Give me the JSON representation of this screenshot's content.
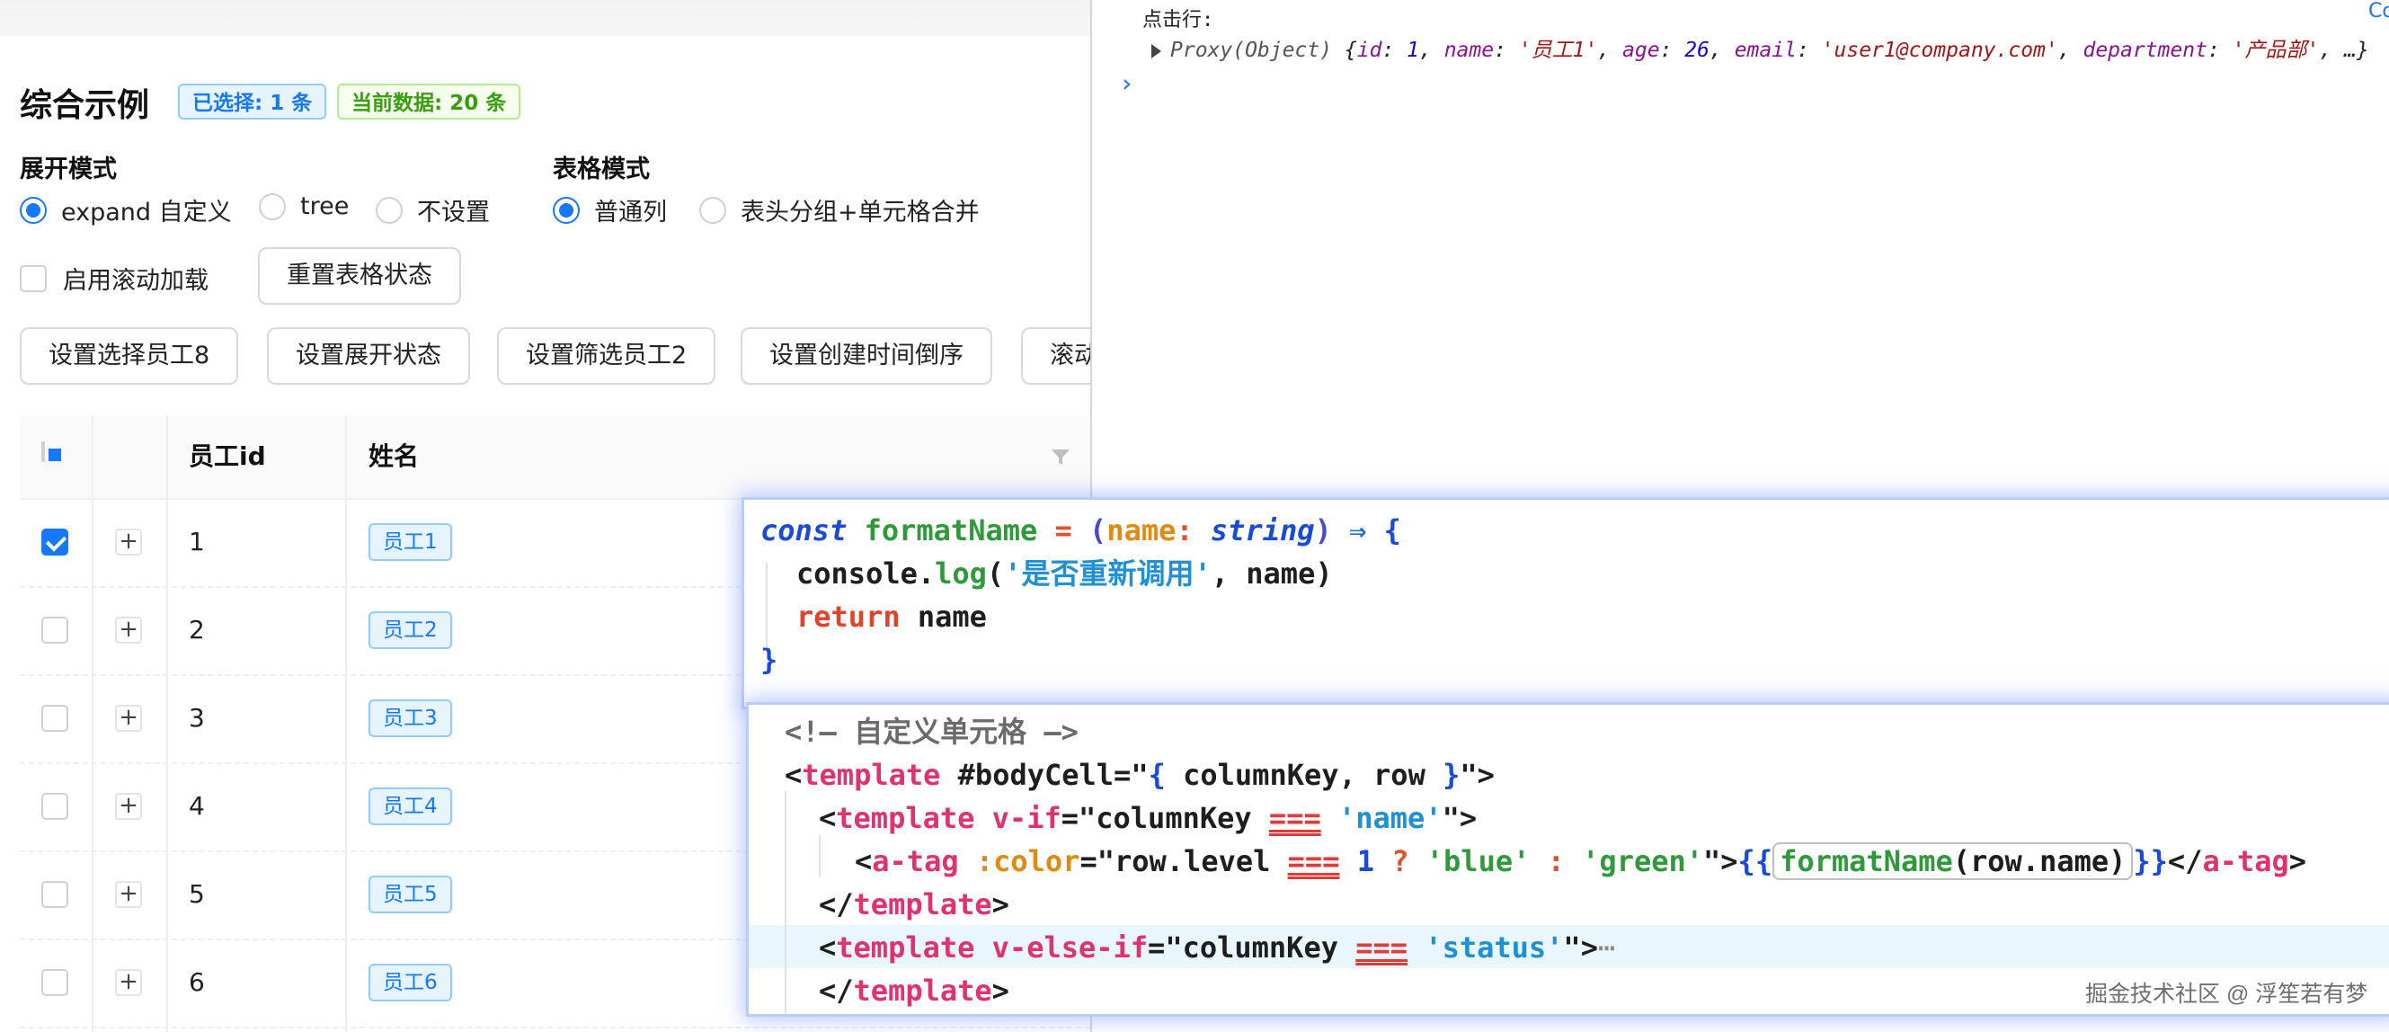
{
  "demo": {
    "title": "综合示例",
    "selected_badge": "已选择: 1 条",
    "data_badge": "当前数据: 20 条",
    "expand_mode": {
      "label": "展开模式",
      "options": [
        "expand 自定义",
        "tree",
        "不设置"
      ],
      "selected": "expand 自定义"
    },
    "table_mode": {
      "label": "表格模式",
      "options": [
        "普通列",
        "表头分组+单元格合并"
      ],
      "selected": "普通列"
    },
    "scroll_load_label": "启用滚动加载",
    "reset_button": "重置表格状态",
    "actions": [
      "设置选择员工8",
      "设置展开状态",
      "设置筛选员工2",
      "设置创建时间倒序",
      "滚动"
    ],
    "table": {
      "columns": [
        "员工id",
        "姓名"
      ],
      "rows": [
        {
          "id": "1",
          "name": "员工1",
          "checked": true
        },
        {
          "id": "2",
          "name": "员工2",
          "checked": false
        },
        {
          "id": "3",
          "name": "员工3",
          "checked": false
        },
        {
          "id": "4",
          "name": "员工4",
          "checked": false
        },
        {
          "id": "5",
          "name": "员工5",
          "checked": false
        },
        {
          "id": "6",
          "name": "员工6",
          "checked": false
        }
      ],
      "expand_symbol": "+"
    }
  },
  "console": {
    "label": "点击行:",
    "proxy_prefix": "Proxy(Object)",
    "obj": {
      "open": "{",
      "id_key": "id",
      "id_val": "1",
      "name_key": "name",
      "name_val": "'员工1'",
      "age_key": "age",
      "age_val": "26",
      "email_key": "email",
      "email_val": "'user1@company.com'",
      "dept_key": "department",
      "dept_val": "'产品部'",
      "tail": ", …}"
    },
    "prompt": "›",
    "corner": "Co"
  },
  "code1": {
    "const": "const",
    "fn_name": "formatName",
    "eq": "=",
    "lparen": "(",
    "param": "name",
    "colon": ":",
    "type": "string",
    "rparen": ")",
    "arrow": "⇒",
    "lbrace": "{",
    "console": "console.",
    "log": "log",
    "log_open": "(",
    "log_str": "'是否重新调用'",
    "log_rest": ", name)",
    "ret": "return",
    "ret_val": " name",
    "rbrace": "}"
  },
  "code2": {
    "comment": "<!— 自定义单元格 —>",
    "l2_open": "<",
    "l2_tag": "template",
    "l2_attr": " #bodyCell",
    "l2_eq": "=\"",
    "l2_brace_l": "{",
    "l2_mid": " columnKey, row ",
    "l2_brace_r": "}",
    "l2_end": "\">",
    "l3_open": "<",
    "l3_tag": "template",
    "l3_dir": " v-if",
    "l3_mid": "=\"columnKey ",
    "l3_eq": "===",
    "l3_str": " 'name'",
    "l3_end": "\">",
    "l4_open": "<",
    "l4_tag": "a-tag",
    "l4_attr": " :color",
    "l4_mid": "=\"row.level ",
    "l4_eq": "===",
    "l4_num": " 1",
    "l4_q": " ? ",
    "l4_blue": "'blue'",
    "l4_colon": " : ",
    "l4_green": "'green'",
    "l4_end": "\">",
    "l4_mus_l": "{{",
    "l4_call_fn": "formatName",
    "l4_call_arg": "(row.name)",
    "l4_mus_r": "}}",
    "l4_close_open": "</",
    "l4_close_tag": "a-tag",
    "l4_close_end": ">",
    "l5_open": "</",
    "l5_tag": "template",
    "l5_end": ">",
    "l6_open": "<",
    "l6_tag": "template",
    "l6_dir": " v-else-if",
    "l6_mid": "=\"columnKey ",
    "l6_eq": "===",
    "l6_str": " 'status'",
    "l6_end": "\">",
    "l6_fold": "⋯",
    "l7_open": "</",
    "l7_tag": "template",
    "l7_end": ">"
  },
  "watermark": "掘金技术社区 @ 浮笙若有梦",
  "colors": {
    "accent": "#1677ff",
    "success": "#389e0d",
    "tag_border": "#91caff",
    "code_keyword": "#1a4ad9",
    "code_tag": "#e0326e",
    "code_string": "#1f8fd6",
    "code_function": "#2f9a3a",
    "overlay_glow": "#b9cdfd"
  }
}
